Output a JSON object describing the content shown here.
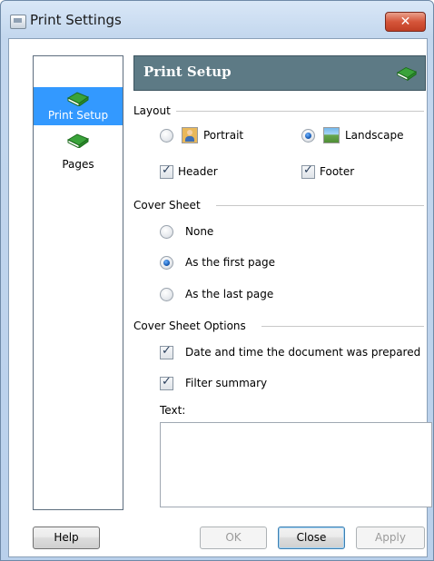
{
  "window": {
    "title": "Print Settings",
    "close_label": "✕"
  },
  "nav": {
    "items": [
      {
        "label": "Print Setup",
        "icon": "book-icon",
        "selected": true
      },
      {
        "label": "Pages",
        "icon": "book-icon",
        "selected": false
      }
    ]
  },
  "header": {
    "title": "Print Setup",
    "icon": "book-icon"
  },
  "layout": {
    "section_label": "Layout",
    "orientation": [
      {
        "label": "Portrait",
        "checked": false,
        "icon": "portrait-icon"
      },
      {
        "label": "Landscape",
        "checked": true,
        "icon": "landscape-icon"
      }
    ],
    "header_label": "Header",
    "header_checked": true,
    "footer_label": "Footer",
    "footer_checked": true
  },
  "cover_sheet": {
    "section_label": "Cover Sheet",
    "options": [
      {
        "label": "None",
        "checked": false
      },
      {
        "label": "As the first page",
        "checked": true
      },
      {
        "label": "As the last page",
        "checked": false
      }
    ]
  },
  "cover_sheet_options": {
    "section_label": "Cover Sheet Options",
    "date_time_label": "Date and time the document was prepared",
    "date_time_checked": true,
    "filter_summary_label": "Filter summary",
    "filter_summary_checked": true,
    "text_label": "Text:",
    "text_value": ""
  },
  "buttons": {
    "help": "Help",
    "ok": "OK",
    "close": "Close",
    "apply": "Apply"
  },
  "colors": {
    "header_bar": "#5d7a85",
    "selection": "#3399ff",
    "close_button": "#c9462a"
  }
}
